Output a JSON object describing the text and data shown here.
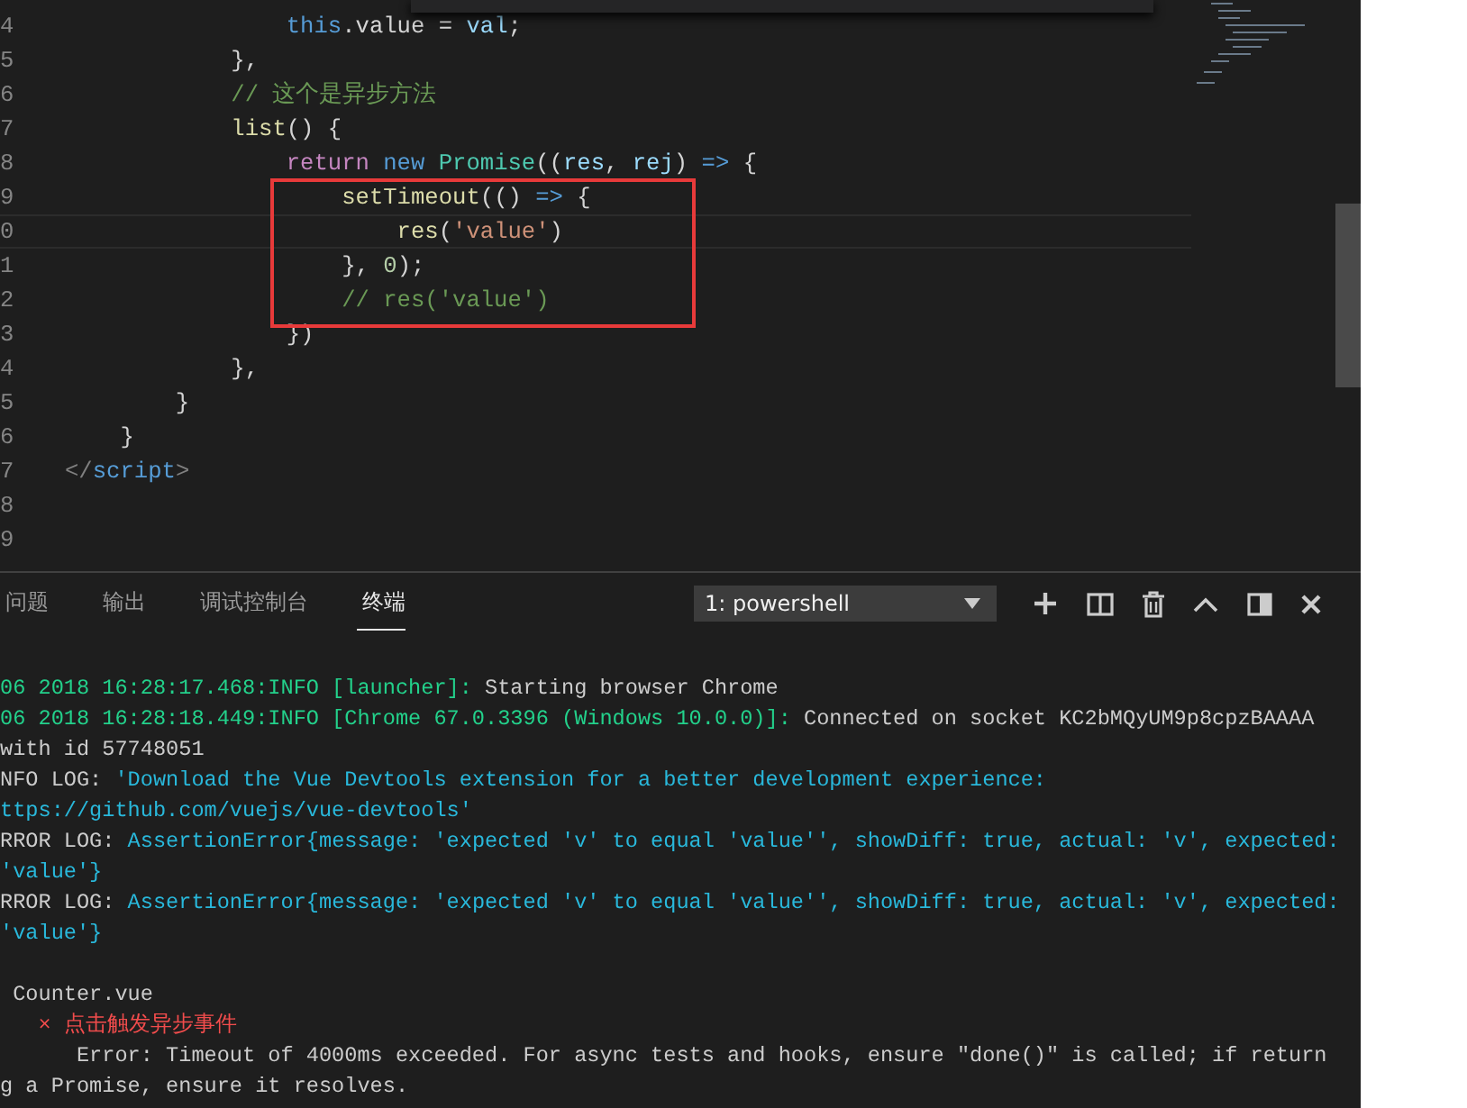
{
  "editor": {
    "lines": [
      {
        "number": "4",
        "current": false,
        "tokens": [
          {
            "text": "                this",
            "color": "#569cd6"
          },
          {
            "text": ".value = ",
            "color": "#d4d4d4"
          },
          {
            "text": "val",
            "color": "#9cdcfe"
          },
          {
            "text": ";",
            "color": "#d4d4d4"
          }
        ]
      },
      {
        "number": "5",
        "current": false,
        "tokens": [
          {
            "text": "            },",
            "color": "#d4d4d4"
          }
        ]
      },
      {
        "number": "6",
        "current": false,
        "tokens": [
          {
            "text": "            // 这个是异步方法",
            "color": "#6a9955"
          }
        ]
      },
      {
        "number": "7",
        "current": false,
        "tokens": [
          {
            "text": "            list",
            "color": "#dcdcaa"
          },
          {
            "text": "() {",
            "color": "#d4d4d4"
          }
        ]
      },
      {
        "number": "8",
        "current": false,
        "tokens": [
          {
            "text": "                return",
            "color": "#c586c0"
          },
          {
            "text": " new",
            "color": "#569cd6"
          },
          {
            "text": " Promise",
            "color": "#4ec9b0"
          },
          {
            "text": "((",
            "color": "#d4d4d4"
          },
          {
            "text": "res",
            "color": "#9cdcfe"
          },
          {
            "text": ", ",
            "color": "#d4d4d4"
          },
          {
            "text": "rej",
            "color": "#9cdcfe"
          },
          {
            "text": ") ",
            "color": "#d4d4d4"
          },
          {
            "text": "=>",
            "color": "#569cd6"
          },
          {
            "text": " {",
            "color": "#d4d4d4"
          }
        ]
      },
      {
        "number": "9",
        "current": false,
        "tokens": [
          {
            "text": "                    setTimeout",
            "color": "#dcdcaa"
          },
          {
            "text": "(() ",
            "color": "#d4d4d4"
          },
          {
            "text": "=>",
            "color": "#569cd6"
          },
          {
            "text": " {",
            "color": "#d4d4d4"
          }
        ]
      },
      {
        "number": "0",
        "current": true,
        "tokens": [
          {
            "text": "                        res",
            "color": "#dcdcaa"
          },
          {
            "text": "(",
            "color": "#d4d4d4"
          },
          {
            "text": "'value'",
            "color": "#ce9178"
          },
          {
            "text": ")",
            "color": "#d4d4d4"
          }
        ]
      },
      {
        "number": "1",
        "current": false,
        "tokens": [
          {
            "text": "                    }, ",
            "color": "#d4d4d4"
          },
          {
            "text": "0",
            "color": "#b5cea8"
          },
          {
            "text": ");",
            "color": "#d4d4d4"
          }
        ]
      },
      {
        "number": "2",
        "current": false,
        "tokens": [
          {
            "text": "                    // res('value')",
            "color": "#6a9955"
          }
        ]
      },
      {
        "number": "3",
        "current": false,
        "tokens": [
          {
            "text": "                })",
            "color": "#d4d4d4"
          }
        ]
      },
      {
        "number": "4",
        "current": false,
        "tokens": [
          {
            "text": "            },",
            "color": "#d4d4d4"
          }
        ]
      },
      {
        "number": "5",
        "current": false,
        "tokens": [
          {
            "text": "        }",
            "color": "#d4d4d4"
          }
        ]
      },
      {
        "number": "6",
        "current": false,
        "tokens": [
          {
            "text": "    }",
            "color": "#d4d4d4"
          }
        ]
      },
      {
        "number": "7",
        "current": false,
        "tokens": [
          {
            "text": "</",
            "color": "#808080"
          },
          {
            "text": "script",
            "color": "#569cd6"
          },
          {
            "text": ">",
            "color": "#808080"
          }
        ]
      },
      {
        "number": "8",
        "current": false
      },
      {
        "number": "9",
        "current": false
      }
    ]
  },
  "panel": {
    "tabs": [
      {
        "label": "问题",
        "selected": false
      },
      {
        "label": "输出",
        "selected": false
      },
      {
        "label": "调试控制台",
        "selected": false
      },
      {
        "label": "终端",
        "selected": true
      }
    ],
    "terminal_select": {
      "value": "1: powershell"
    },
    "terminal": [
      {
        "kind": "text",
        "segments": [
          {
            "text": "06 2018 16:28:17.468:INFO [launcher]:",
            "color": "#23d18b"
          },
          {
            "text": " Starting browser Chrome",
            "color": "#cccccc"
          }
        ]
      },
      {
        "kind": "text",
        "segments": [
          {
            "text": "06 2018 16:28:18.449:INFO [Chrome 67.0.3396 (Windows 10.0.0)]:",
            "color": "#23d18b"
          },
          {
            "text": " Connected on socket KC2bMQyUM9p8cpzBAAAA",
            "color": "#cccccc"
          }
        ]
      },
      {
        "kind": "text",
        "segments": [
          {
            "text": "with id 57748051",
            "color": "#cccccc"
          }
        ]
      },
      {
        "kind": "text",
        "segments": [
          {
            "text": "NFO LOG: ",
            "color": "#cccccc"
          },
          {
            "text": "'Download the Vue Devtools extension for a better development experience:",
            "color": "#29b8db"
          }
        ]
      },
      {
        "kind": "text",
        "segments": [
          {
            "text": "ttps://github.com/vuejs/vue-devtools'",
            "color": "#29b8db"
          }
        ]
      },
      {
        "kind": "text",
        "segments": [
          {
            "text": "RROR LOG: ",
            "color": "#cccccc"
          },
          {
            "text": "AssertionError{message: 'expected 'v' to equal 'value'', showDiff: true, actual: 'v', expected:",
            "color": "#29b8db"
          }
        ]
      },
      {
        "kind": "text",
        "segments": [
          {
            "text": "'value'}",
            "color": "#29b8db"
          }
        ]
      },
      {
        "kind": "text",
        "segments": [
          {
            "text": "RROR LOG: ",
            "color": "#cccccc"
          },
          {
            "text": "AssertionError{message: 'expected 'v' to equal 'value'', showDiff: true, actual: 'v', expected:",
            "color": "#29b8db"
          }
        ]
      },
      {
        "kind": "text",
        "segments": [
          {
            "text": "'value'}",
            "color": "#29b8db"
          }
        ]
      },
      {
        "kind": "blank"
      },
      {
        "kind": "text",
        "segments": [
          {
            "text": " Counter.vue",
            "color": "#cccccc"
          }
        ]
      },
      {
        "kind": "text",
        "segments": [
          {
            "text": "   × 点击触发异步事件",
            "color": "#f14c4c"
          }
        ]
      },
      {
        "kind": "text",
        "segments": [
          {
            "text": "      Error: Timeout of 4000ms exceeded. For async tests and hooks, ensure \"done()\" is called; if return",
            "color": "#cccccc"
          }
        ]
      },
      {
        "kind": "text",
        "segments": [
          {
            "text": "g a Promise, ensure it resolves.",
            "color": "#cccccc"
          }
        ]
      }
    ]
  }
}
